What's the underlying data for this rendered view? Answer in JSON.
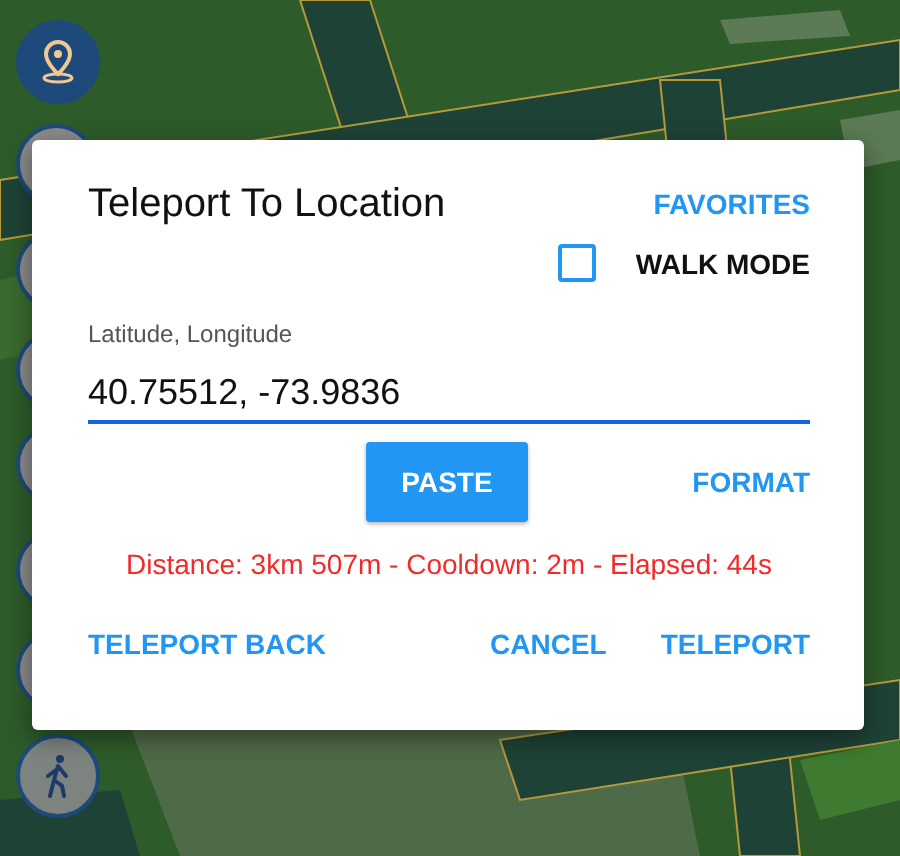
{
  "dialog": {
    "title": "Teleport To Location",
    "favorites_button": "FAVORITES",
    "walk_mode": {
      "label": "WALK MODE",
      "checked": false
    },
    "coordinates": {
      "label": "Latitude, Longitude",
      "value": "40.75512, -73.9836"
    },
    "paste_button": "PASTE",
    "format_button": "FORMAT",
    "status": "Distance: 3km 507m - Cooldown: 2m - Elapsed: 44s",
    "actions": [
      "TELEPORT BACK",
      "CANCEL",
      "TELEPORT"
    ]
  }
}
